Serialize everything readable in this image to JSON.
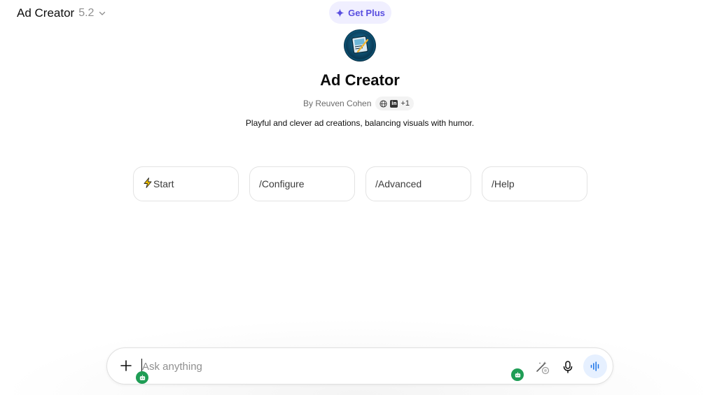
{
  "header": {
    "model_name": "Ad Creator",
    "model_version": "5.2",
    "upgrade_label": "Get Plus"
  },
  "gpt": {
    "title": "Ad Creator",
    "byline": "By Reuven Cohen",
    "social_more": "+1",
    "description": "Playful and clever ad creations, balancing visuals with humor."
  },
  "starters": [
    {
      "label": "Start",
      "icon": "lightning-bolt-icon"
    },
    {
      "label": "/Configure"
    },
    {
      "label": "/Advanced"
    },
    {
      "label": "/Help"
    }
  ],
  "composer": {
    "placeholder": "Ask anything"
  },
  "colors": {
    "accent": "#5a4fe0",
    "upgrade_bg": "#f0efff",
    "voice_bg": "#e6f0ff",
    "badge_green": "#1f9d55"
  }
}
